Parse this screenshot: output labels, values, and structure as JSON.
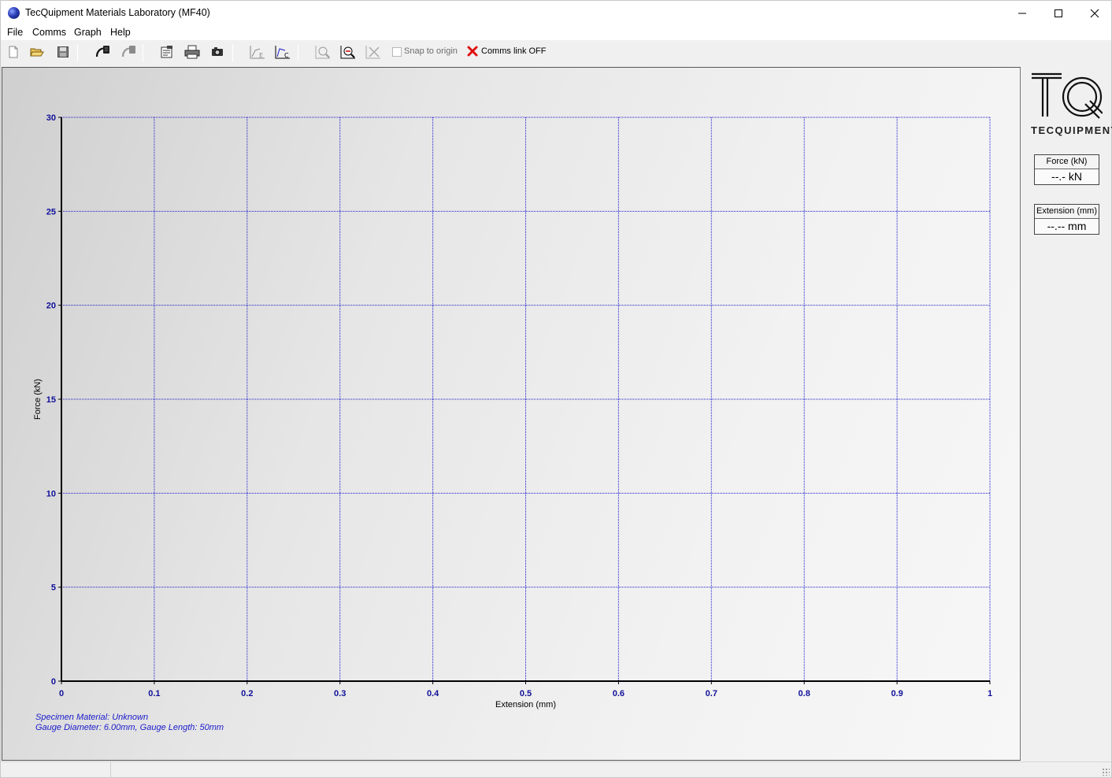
{
  "window": {
    "title": "TecQuipment Materials Laboratory (MF40)"
  },
  "menu": {
    "items": [
      "File",
      "Comms",
      "Graph",
      "Help"
    ]
  },
  "toolbar": {
    "snap_label": "Snap to origin",
    "snap_checked": false,
    "comms_label": "Comms link OFF",
    "comms_status_color": "#e01010",
    "icons": [
      "new-file-icon",
      "open-folder-icon",
      "save-icon",
      "connect-icon",
      "disconnect-icon",
      "report-icon",
      "print-icon",
      "camera-icon",
      "graph-e-icon",
      "graph-c-icon",
      "zoom-in-icon",
      "zoom-out-icon",
      "clear-graph-icon"
    ]
  },
  "specimen": {
    "line1": "Specimen Material: Unknown",
    "line2": "Gauge Diameter: 6.00mm,  Gauge Length: 50mm"
  },
  "readouts": {
    "force_label": "Force (kN)",
    "force_value": "--.- kN",
    "extension_label": "Extension (mm)",
    "extension_value": "--.-- mm"
  },
  "logo": {
    "text": "TECQUIPMENT"
  },
  "colors": {
    "axis_text": "#10109a",
    "grid": "#1a1acc",
    "info_text": "#1a1acc"
  },
  "chart_data": {
    "type": "line",
    "title": "",
    "xlabel": "Extension (mm)",
    "ylabel": "Force (kN)",
    "xlim": [
      0,
      1
    ],
    "ylim": [
      0,
      30
    ],
    "x_ticks": [
      "0",
      "0.1",
      "0.2",
      "0.3",
      "0.4",
      "0.5",
      "0.6",
      "0.7",
      "0.8",
      "0.9",
      "1"
    ],
    "y_ticks": [
      "0",
      "5",
      "10",
      "15",
      "20",
      "25",
      "30"
    ],
    "grid": true,
    "series": []
  }
}
